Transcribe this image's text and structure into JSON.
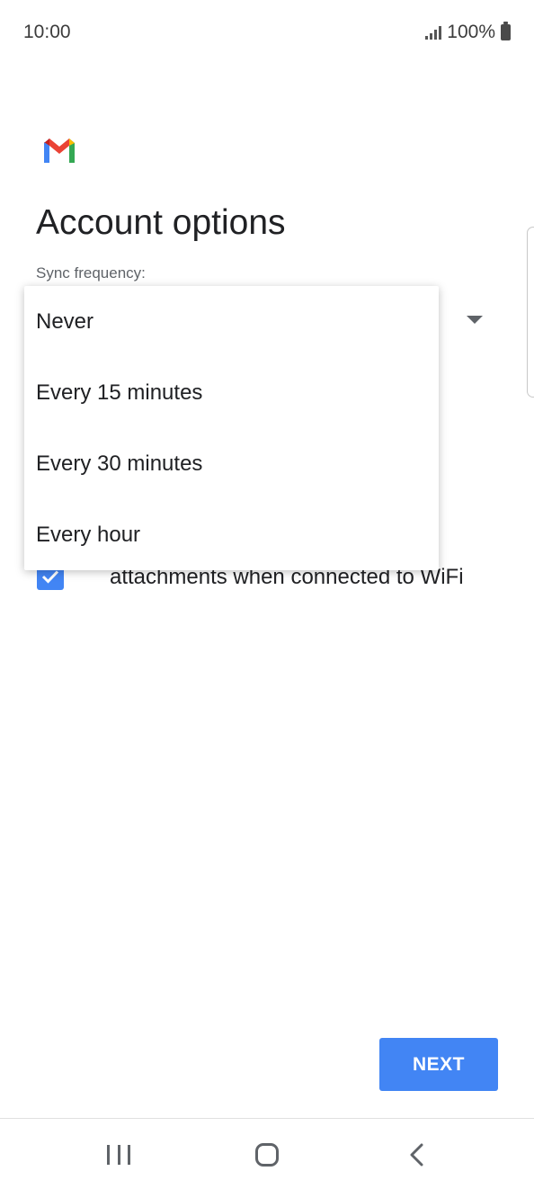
{
  "status_bar": {
    "time": "10:00",
    "battery_percent": "100%",
    "icons": [
      "signal-icon",
      "battery-icon"
    ]
  },
  "app": {
    "logo": "gmail-logo",
    "colors": {
      "accent": "#4285f4",
      "gmail_red": "#ea4335",
      "gmail_yellow": "#fbbc04",
      "gmail_green": "#34a853",
      "gmail_blue": "#4285f4"
    }
  },
  "page": {
    "title": "Account options",
    "sync_label": "Sync frequency:"
  },
  "dropdown": {
    "options": [
      "Never",
      "Every 15 minutes",
      "Every 30 minutes",
      "Every hour"
    ]
  },
  "checkbox": {
    "checked": true,
    "label": "attachments when connected to WiFi"
  },
  "footer": {
    "next_label": "NEXT"
  },
  "nav_bar": {
    "icons": [
      "recents-icon",
      "home-icon",
      "back-icon"
    ]
  }
}
